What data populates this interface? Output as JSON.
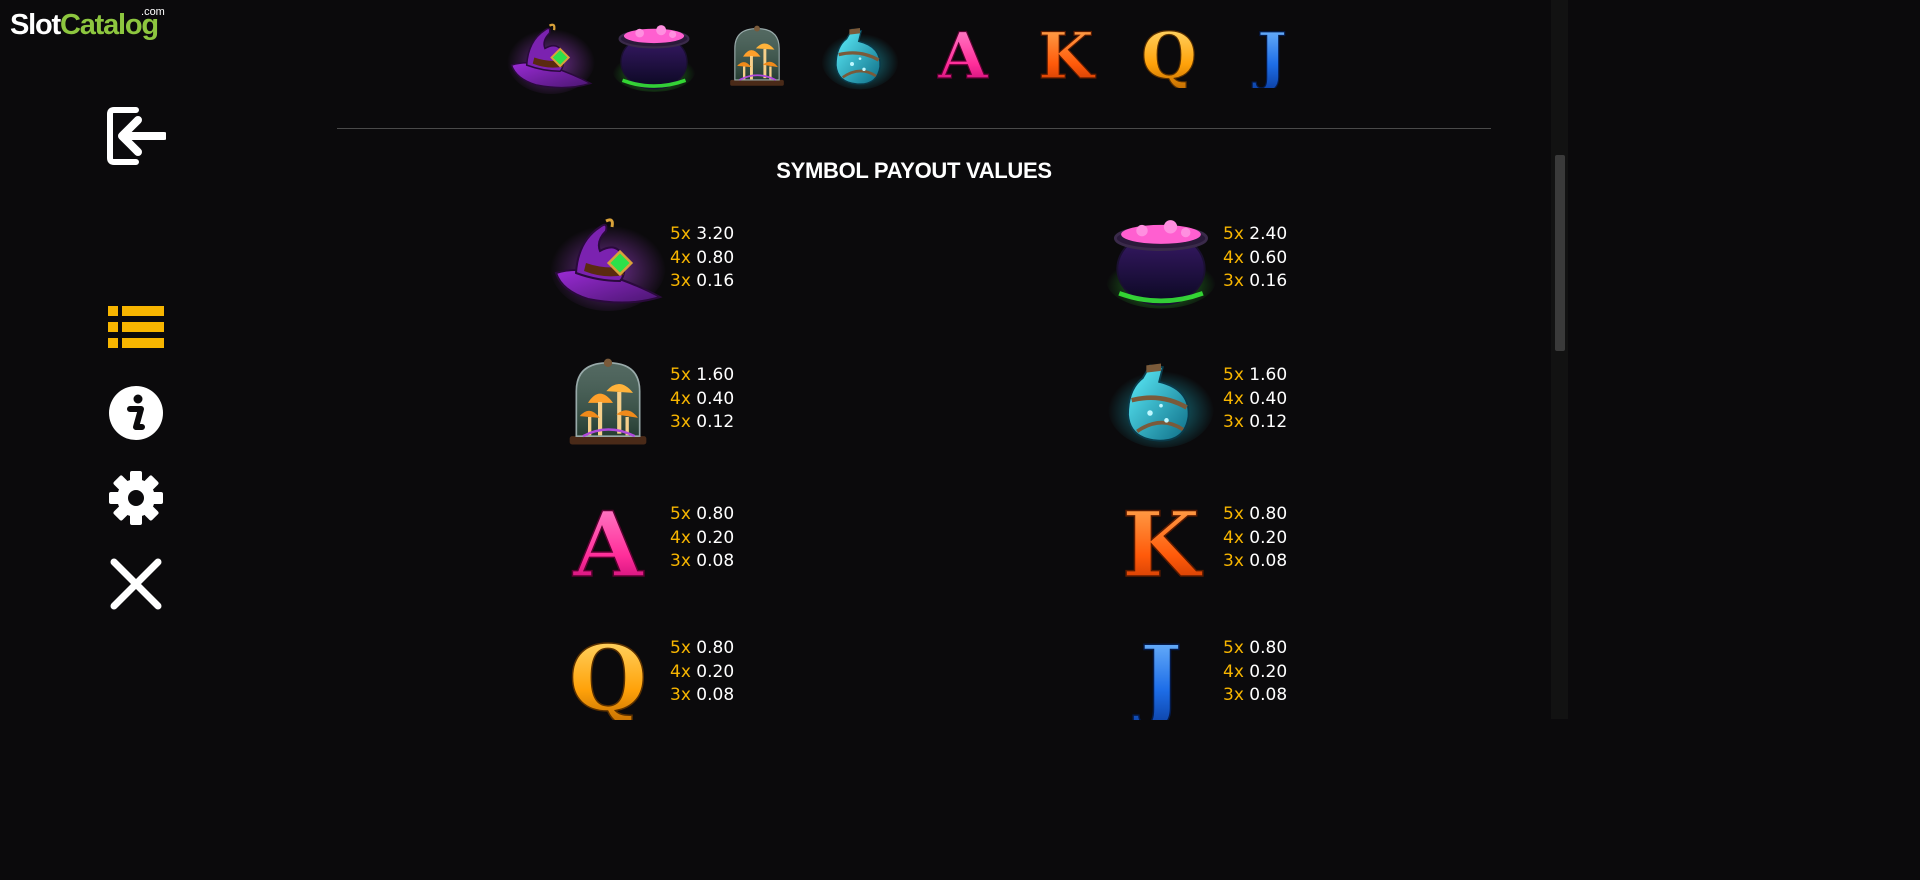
{
  "logo": {
    "brand_part1": "Slot",
    "brand_part2": "Catalog",
    "suffix": "com"
  },
  "sidebar": {
    "items": [
      {
        "name": "exit",
        "icon": "exit-icon"
      },
      {
        "name": "paytable",
        "icon": "list-icon",
        "active": true
      },
      {
        "name": "info",
        "icon": "info-icon"
      },
      {
        "name": "settings",
        "icon": "gear-icon"
      },
      {
        "name": "close",
        "icon": "close-icon"
      }
    ]
  },
  "top_strip": {
    "symbols": [
      "witch-hat-icon",
      "cauldron-icon",
      "mushroom-jar-icon",
      "potion-bottle-icon",
      "A",
      "K",
      "Q",
      "J"
    ]
  },
  "section_title": "SYMBOL PAYOUT VALUES",
  "payouts": [
    {
      "symbol": "witch-hat-icon",
      "lines": [
        {
          "mult": "5x",
          "value": "3.20"
        },
        {
          "mult": "4x",
          "value": "0.80"
        },
        {
          "mult": "3x",
          "value": "0.16"
        }
      ]
    },
    {
      "symbol": "cauldron-icon",
      "lines": [
        {
          "mult": "5x",
          "value": "2.40"
        },
        {
          "mult": "4x",
          "value": "0.60"
        },
        {
          "mult": "3x",
          "value": "0.16"
        }
      ]
    },
    {
      "symbol": "mushroom-jar-icon",
      "lines": [
        {
          "mult": "5x",
          "value": "1.60"
        },
        {
          "mult": "4x",
          "value": "0.40"
        },
        {
          "mult": "3x",
          "value": "0.12"
        }
      ]
    },
    {
      "symbol": "potion-bottle-icon",
      "lines": [
        {
          "mult": "5x",
          "value": "1.60"
        },
        {
          "mult": "4x",
          "value": "0.40"
        },
        {
          "mult": "3x",
          "value": "0.12"
        }
      ]
    },
    {
      "symbol": "A",
      "lines": [
        {
          "mult": "5x",
          "value": "0.80"
        },
        {
          "mult": "4x",
          "value": "0.20"
        },
        {
          "mult": "3x",
          "value": "0.08"
        }
      ]
    },
    {
      "symbol": "K",
      "lines": [
        {
          "mult": "5x",
          "value": "0.80"
        },
        {
          "mult": "4x",
          "value": "0.20"
        },
        {
          "mult": "3x",
          "value": "0.08"
        }
      ]
    },
    {
      "symbol": "Q",
      "lines": [
        {
          "mult": "5x",
          "value": "0.80"
        },
        {
          "mult": "4x",
          "value": "0.20"
        },
        {
          "mult": "3x",
          "value": "0.08"
        }
      ]
    },
    {
      "symbol": "J",
      "lines": [
        {
          "mult": "5x",
          "value": "0.80"
        },
        {
          "mult": "4x",
          "value": "0.20"
        },
        {
          "mult": "3x",
          "value": "0.08"
        }
      ]
    }
  ],
  "colors": {
    "background": "#0b0a0c",
    "multiplier": "#f7b500",
    "active_icon": "#f7b500",
    "brand_green": "#8dc63f",
    "letter_A": "#ff2e9a",
    "letter_K": "#ff5a0a",
    "letter_Q": "#ffa20a",
    "letter_J": "#1e6ee8"
  }
}
